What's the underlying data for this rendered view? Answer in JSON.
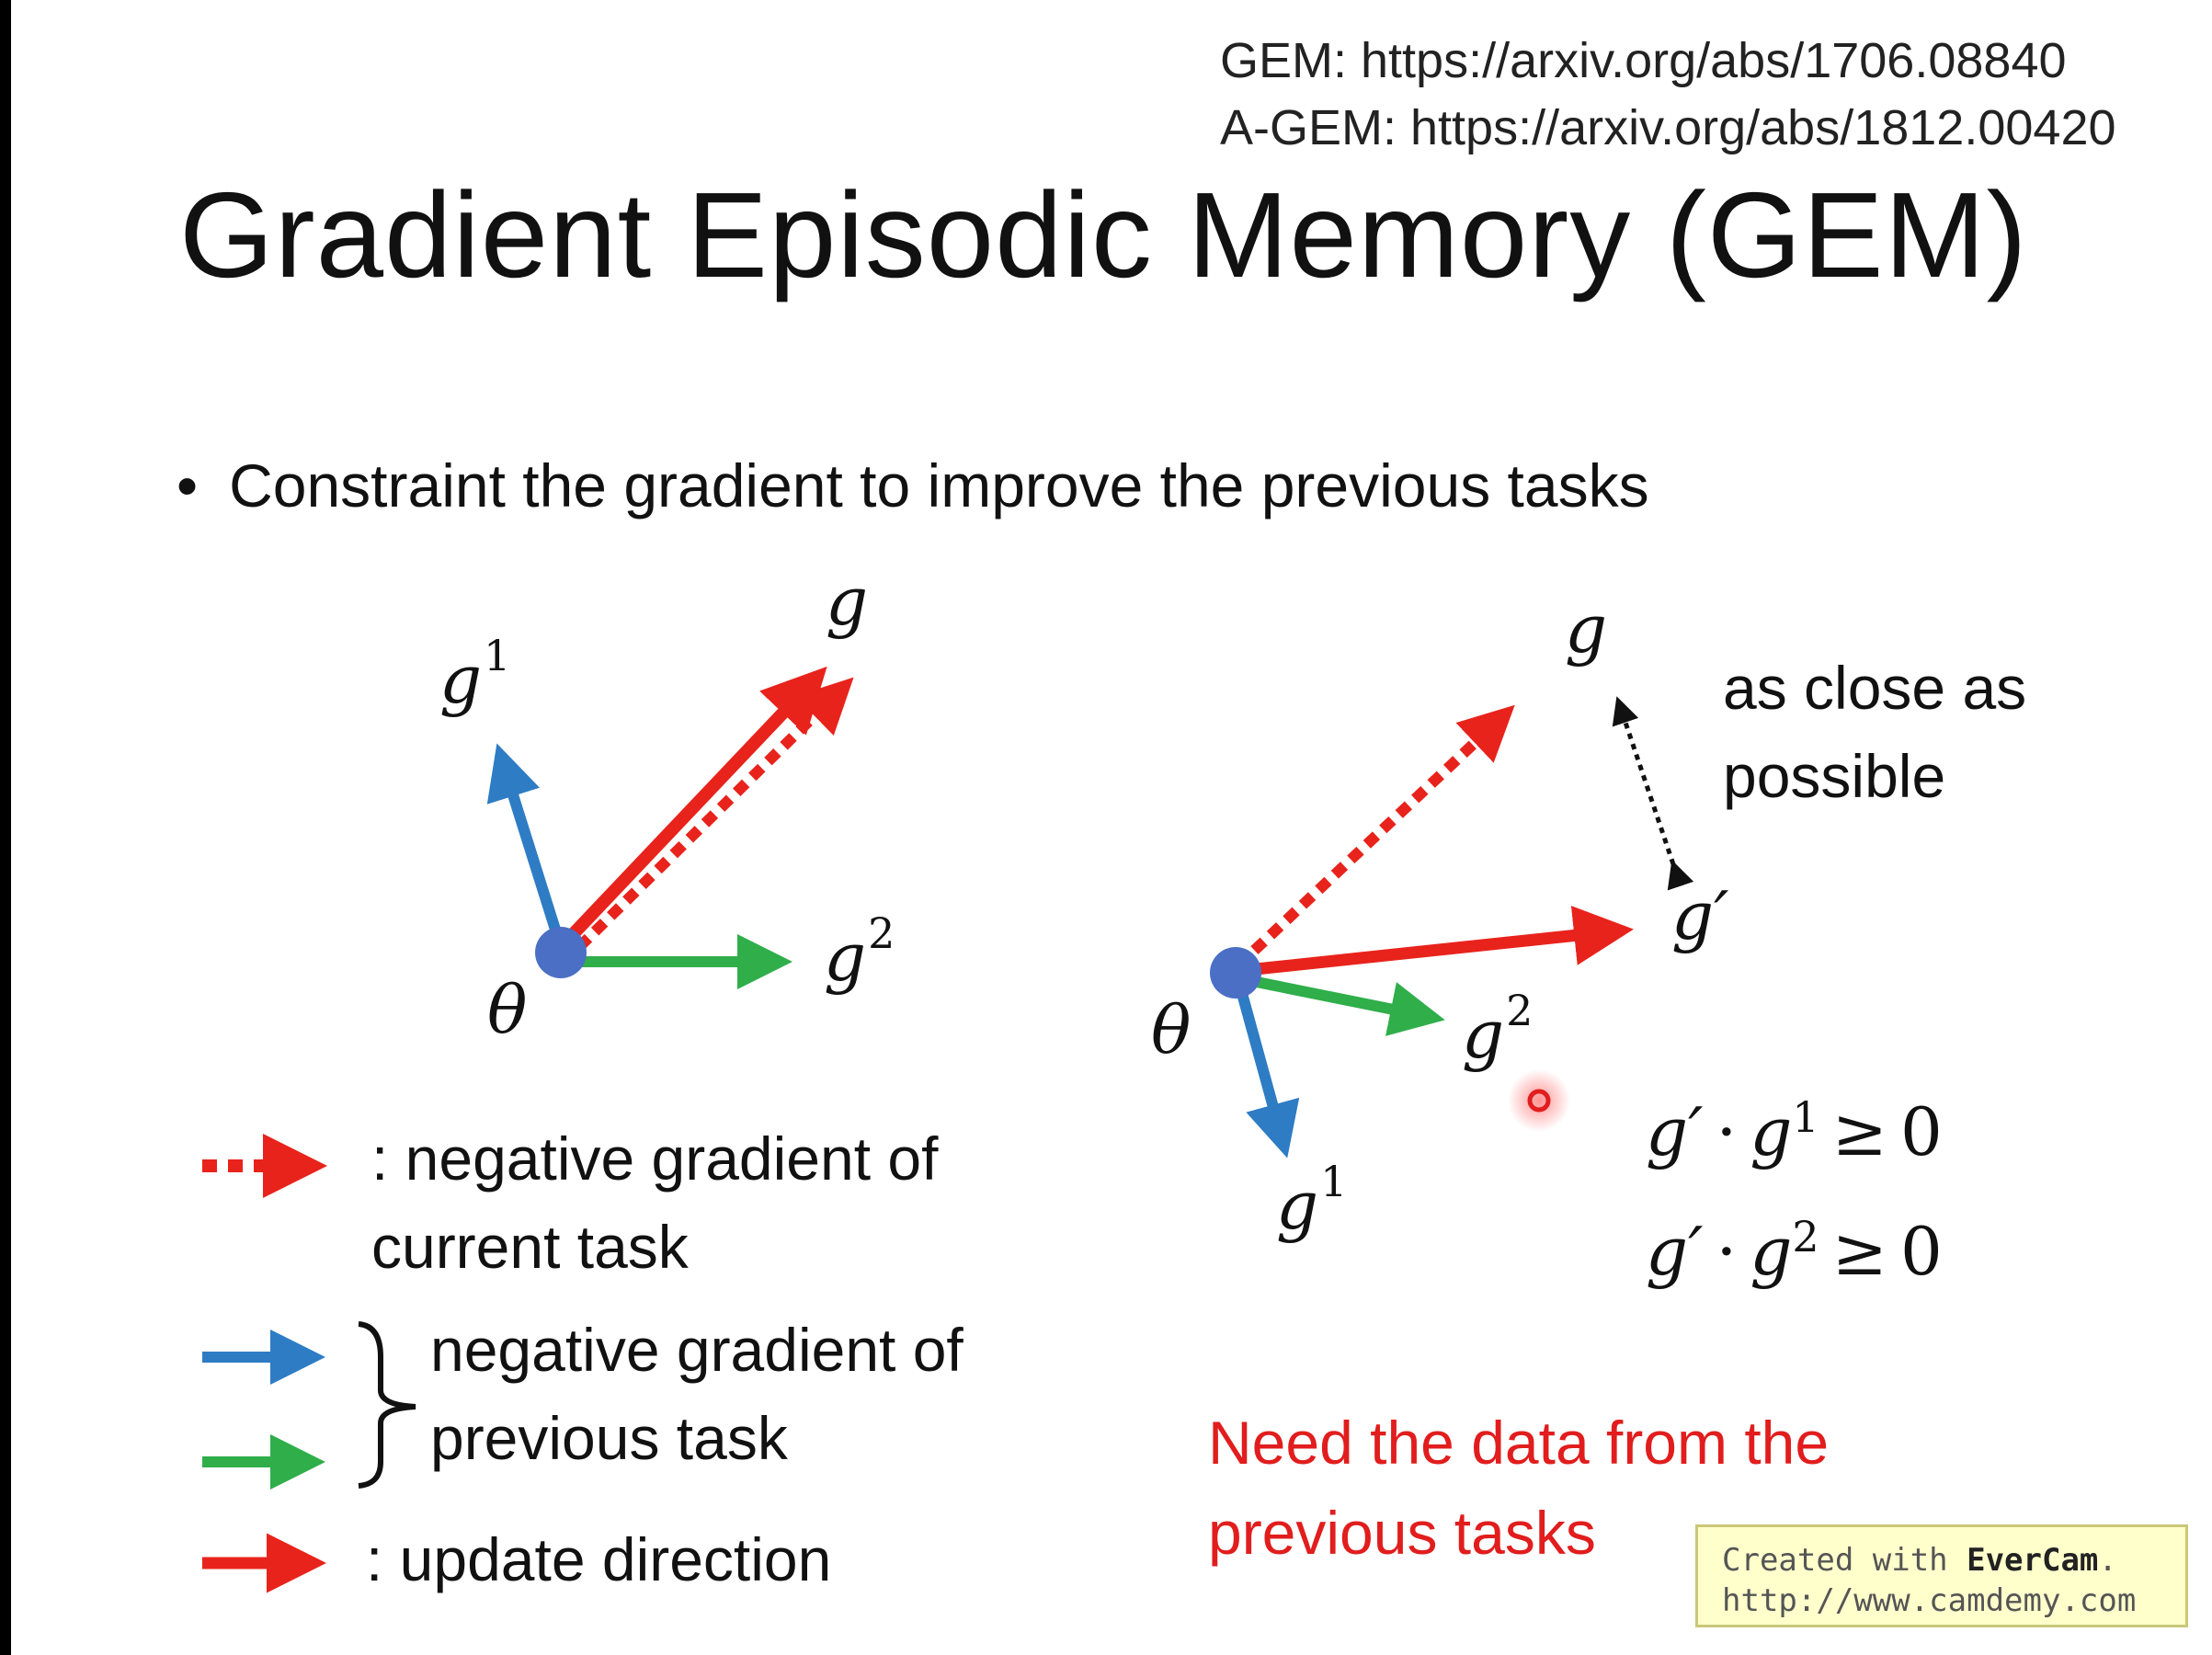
{
  "references": {
    "gem": "GEM: https://arxiv.org/abs/1706.08840",
    "agem": "A-GEM: https://arxiv.org/abs/1812.00420"
  },
  "title": "Gradient Episodic Memory (GEM)",
  "bullet": "Constraint the gradient to improve the previous tasks",
  "left_diagram": {
    "labels": {
      "g": "g",
      "g1_base": "g",
      "g1_sup": "1",
      "g2_base": "g",
      "g2_sup": "2",
      "theta": "θ"
    }
  },
  "right_diagram": {
    "labels": {
      "g": "g",
      "g_prime": "g′",
      "g1_base": "g",
      "g1_sup": "1",
      "g2_base": "g",
      "g2_sup": "2",
      "theta": "θ"
    },
    "annotation_line1": "as close as",
    "annotation_line2": "possible"
  },
  "constraints": {
    "c1": {
      "lhs": "g′",
      "dot": "·",
      "g": "g",
      "sup": "1",
      "op": "≥",
      "rhs": "0"
    },
    "c2": {
      "lhs": "g′",
      "dot": "·",
      "g": "g",
      "sup": "2",
      "op": "≥",
      "rhs": "0"
    }
  },
  "legend": {
    "current_line1": ": negative gradient of",
    "current_line2": "current task",
    "previous_line1": "negative gradient of",
    "previous_line2": "previous task",
    "update": ": update direction"
  },
  "note_line1": "Need the data from the",
  "note_line2": "previous tasks",
  "watermark": {
    "prefix": "Created with ",
    "brand": "EverCam",
    "suffix": ".",
    "url": "http://www.camdemy.com"
  },
  "colors": {
    "red": "#e8231c",
    "blue": "#2e7cc4",
    "green": "#2fae4a",
    "origin_dot": "#4a6fc4",
    "note_red": "#e11d1d"
  }
}
